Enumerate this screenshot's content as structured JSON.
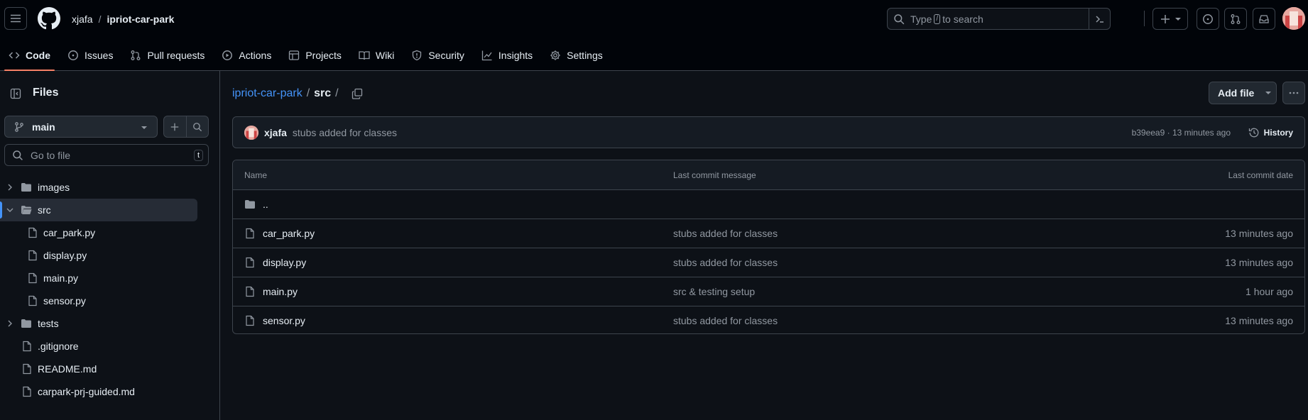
{
  "header": {
    "owner": "xjafa",
    "separator": "/",
    "repo": "ipriot-car-park",
    "search_prefix": "Type",
    "search_key": "/",
    "search_suffix": "to search"
  },
  "tabs": [
    {
      "label": "Code",
      "icon": "code-icon",
      "selected": true
    },
    {
      "label": "Issues",
      "icon": "issue-opened-icon"
    },
    {
      "label": "Pull requests",
      "icon": "git-pull-request-icon"
    },
    {
      "label": "Actions",
      "icon": "play-icon"
    },
    {
      "label": "Projects",
      "icon": "table-icon"
    },
    {
      "label": "Wiki",
      "icon": "book-icon"
    },
    {
      "label": "Security",
      "icon": "shield-icon"
    },
    {
      "label": "Insights",
      "icon": "graph-icon"
    },
    {
      "label": "Settings",
      "icon": "gear-icon"
    }
  ],
  "sidebar": {
    "title": "Files",
    "branch": "main",
    "goto_placeholder": "Go to file",
    "goto_key": "t",
    "tree": [
      {
        "label": "images",
        "type": "dir",
        "expanded": false,
        "depth": 0
      },
      {
        "label": "src",
        "type": "dir",
        "expanded": true,
        "depth": 0,
        "active": true
      },
      {
        "label": "car_park.py",
        "type": "file",
        "depth": 1
      },
      {
        "label": "display.py",
        "type": "file",
        "depth": 1
      },
      {
        "label": "main.py",
        "type": "file",
        "depth": 1
      },
      {
        "label": "sensor.py",
        "type": "file",
        "depth": 1
      },
      {
        "label": "tests",
        "type": "dir",
        "expanded": false,
        "depth": 0
      },
      {
        "label": ".gitignore",
        "type": "file",
        "depth": 0
      },
      {
        "label": "README.md",
        "type": "file",
        "depth": 0
      },
      {
        "label": "carpark-prj-guided.md",
        "type": "file",
        "depth": 0
      }
    ]
  },
  "main": {
    "path_root": "ipriot-car-park",
    "path_sep": "/",
    "path_current": "src",
    "path_trailing": "/",
    "add_file_label": "Add file",
    "commit": {
      "author": "xjafa",
      "message": "stubs added for classes",
      "meta": "b39eea9 · 13 minutes ago",
      "history_label": "History"
    },
    "table": {
      "headers": {
        "name": "Name",
        "message": "Last commit message",
        "date": "Last commit date"
      },
      "parent_label": "..",
      "rows": [
        {
          "name": "car_park.py",
          "message": "stubs added for classes",
          "date": "13 minutes ago"
        },
        {
          "name": "display.py",
          "message": "stubs added for classes",
          "date": "13 minutes ago"
        },
        {
          "name": "main.py",
          "message": "src & testing setup",
          "date": "1 hour ago"
        },
        {
          "name": "sensor.py",
          "message": "stubs added for classes",
          "date": "13 minutes ago"
        }
      ]
    }
  },
  "colors": {
    "background": "#0d1117",
    "header_bg": "#010409",
    "border": "#3d444d",
    "accent_link": "#4493f8",
    "tab_underline": "#f78166",
    "muted_text": "#9198a1"
  }
}
